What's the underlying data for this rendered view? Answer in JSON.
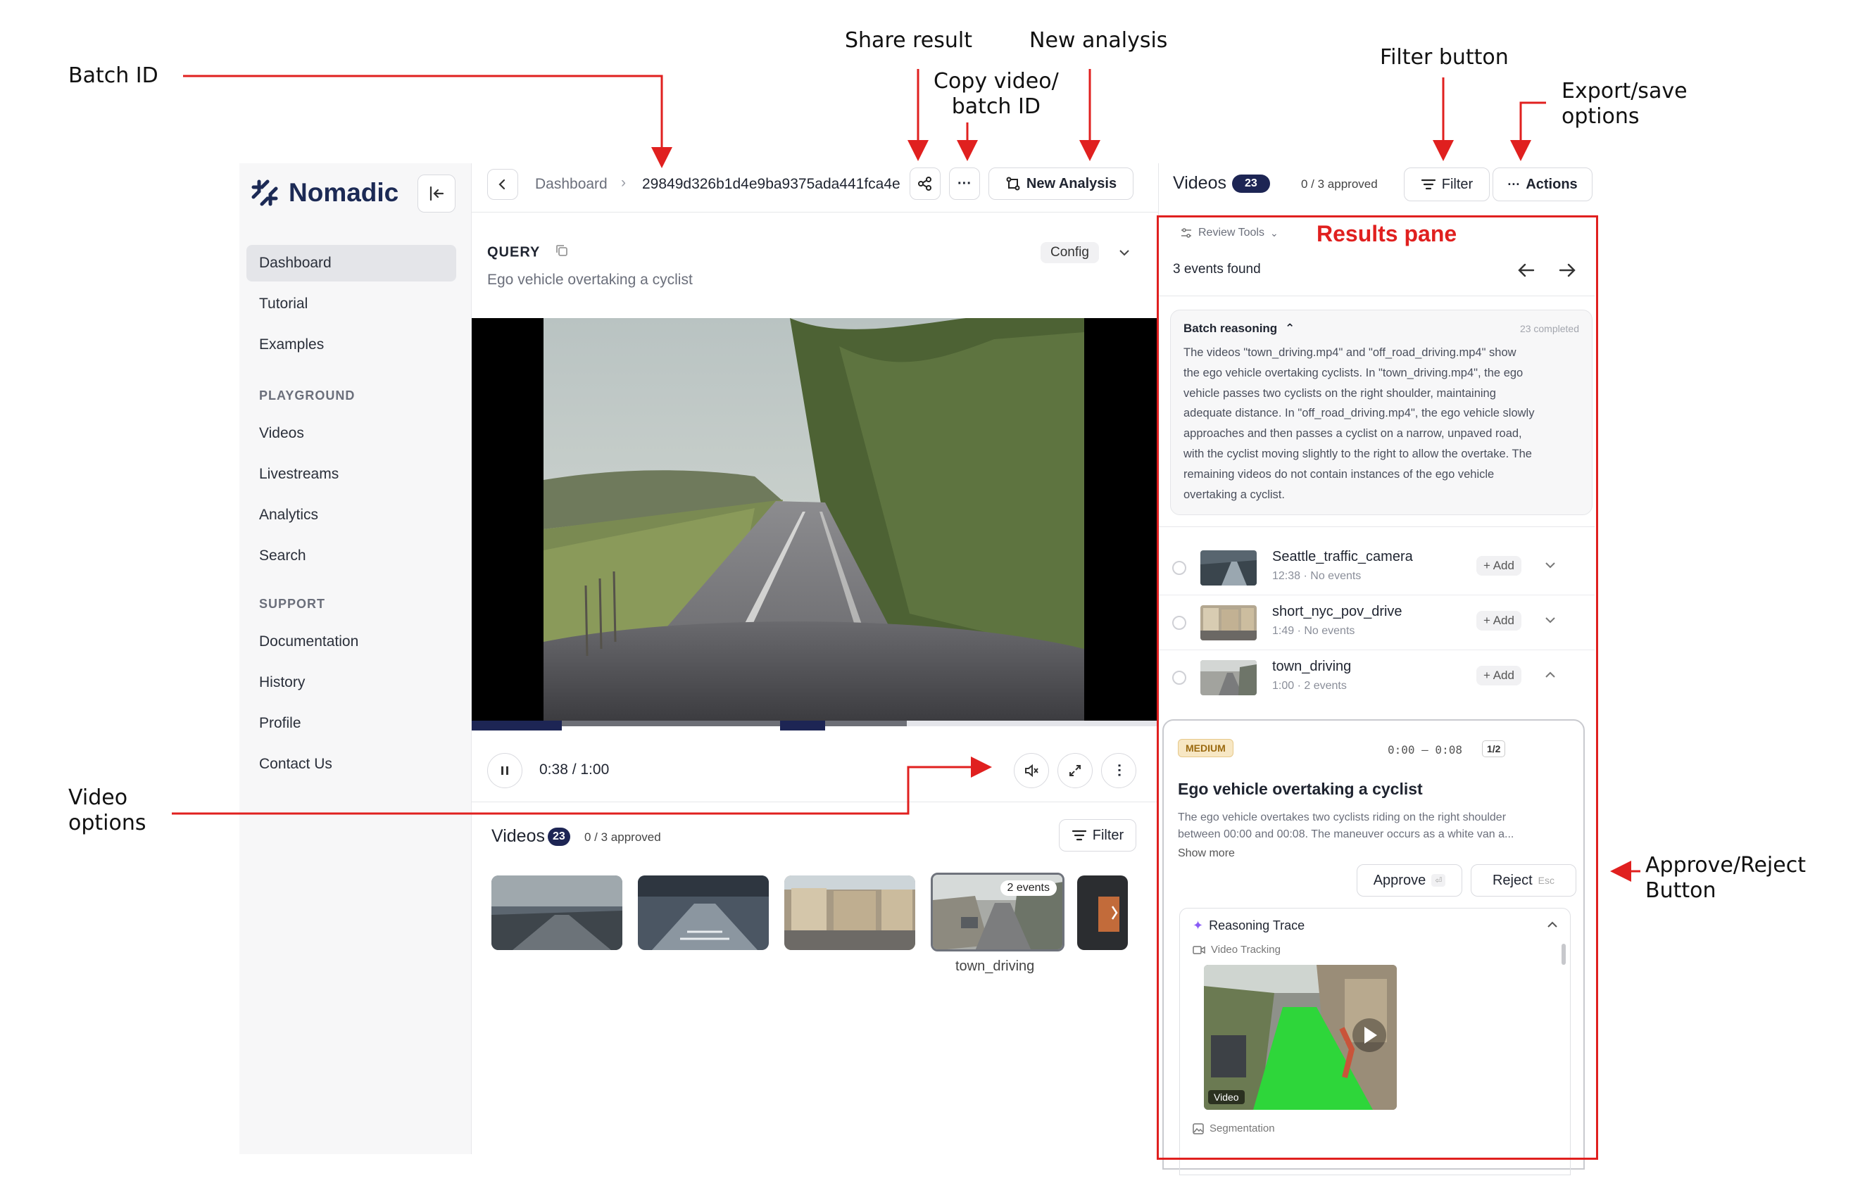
{
  "annotations": {
    "batch_id": "Batch ID",
    "share_result": "Share result",
    "new_analysis": "New analysis",
    "copy_id": "Copy video/\nbatch ID",
    "filter_button": "Filter button",
    "export_save": "Export/save\noptions",
    "results_pane": "Results pane",
    "video_options": "Video\noptions",
    "approve_reject": "Approve/Reject\nButton"
  },
  "colors": {
    "annotation_red": "#e0201f",
    "navy": "#1d2554",
    "medium_badge": "#f7e7c4",
    "segmentation_green": "#22d633"
  },
  "sidebar": {
    "brand": "Nomadic",
    "items": [
      "Dashboard",
      "Tutorial",
      "Examples"
    ],
    "section_playground": "PLAYGROUND",
    "playground_items": [
      "Videos",
      "Livestreams",
      "Analytics",
      "Search"
    ],
    "section_support": "SUPPORT",
    "support_items": [
      "Documentation",
      "History",
      "Profile",
      "Contact Us"
    ]
  },
  "topbar": {
    "breadcrumb_root": "Dashboard",
    "batch_id": "29849d326b1d4e9ba9375ada441fca4e",
    "new_analysis_label": "New Analysis"
  },
  "query": {
    "label": "QUERY",
    "text": "Ego vehicle overtaking a cyclist",
    "config_label": "Config"
  },
  "player": {
    "time": "0:38 / 1:00"
  },
  "video_strip": {
    "title": "Videos",
    "count": "23",
    "approved": "0 / 3 approved",
    "filter_label": "Filter",
    "selected_badge": "2 events",
    "selected_caption": "town_driving"
  },
  "right_header": {
    "title": "Videos",
    "count": "23",
    "approved": "0 / 3 approved",
    "filter_label": "Filter",
    "actions_label": "Actions"
  },
  "results": {
    "review_tools": "Review Tools",
    "events_found": "3 events found",
    "batch_reasoning_title": "Batch reasoning",
    "batch_status": "23 completed",
    "batch_reasoning_lines": [
      "The videos \"town_driving.mp4\" and \"off_road_driving.mp4\" show",
      "the ego vehicle overtaking cyclists. In \"town_driving.mp4\", the ego",
      "vehicle passes two cyclists on the right shoulder, maintaining",
      "adequate distance. In \"off_road_driving.mp4\", the ego vehicle slowly",
      "approaches and then passes a cyclist on a narrow, unpaved road,",
      "with the cyclist moving slightly to the right to allow the overtake. The",
      "remaining videos do not contain instances of the ego vehicle",
      "overtaking a cyclist."
    ],
    "videos": [
      {
        "name": "Seattle_traffic_camera",
        "duration": "12:38",
        "events": "No events",
        "add": "+ Add"
      },
      {
        "name": "short_nyc_pov_drive",
        "duration": "1:49",
        "events": "No events",
        "add": "+ Add"
      },
      {
        "name": "town_driving",
        "duration": "1:00",
        "events": "2 events",
        "add": "+ Add"
      }
    ],
    "event": {
      "severity": "MEDIUM",
      "time_range": "0:00 – 0:08",
      "index": "1/2",
      "title": "Ego vehicle overtaking a cyclist",
      "desc_line1": "The ego vehicle overtakes two cyclists riding on the right shoulder",
      "desc_line2": "between 00:00 and 00:08. The maneuver occurs as a white van a...",
      "show_more": "Show more",
      "approve_label": "Approve",
      "approve_key": "⏎",
      "reject_label": "Reject",
      "reject_key": "Esc",
      "trace_title": "Reasoning Trace",
      "video_tracking": "Video Tracking",
      "video_tag": "Video",
      "segmentation": "Segmentation"
    }
  }
}
